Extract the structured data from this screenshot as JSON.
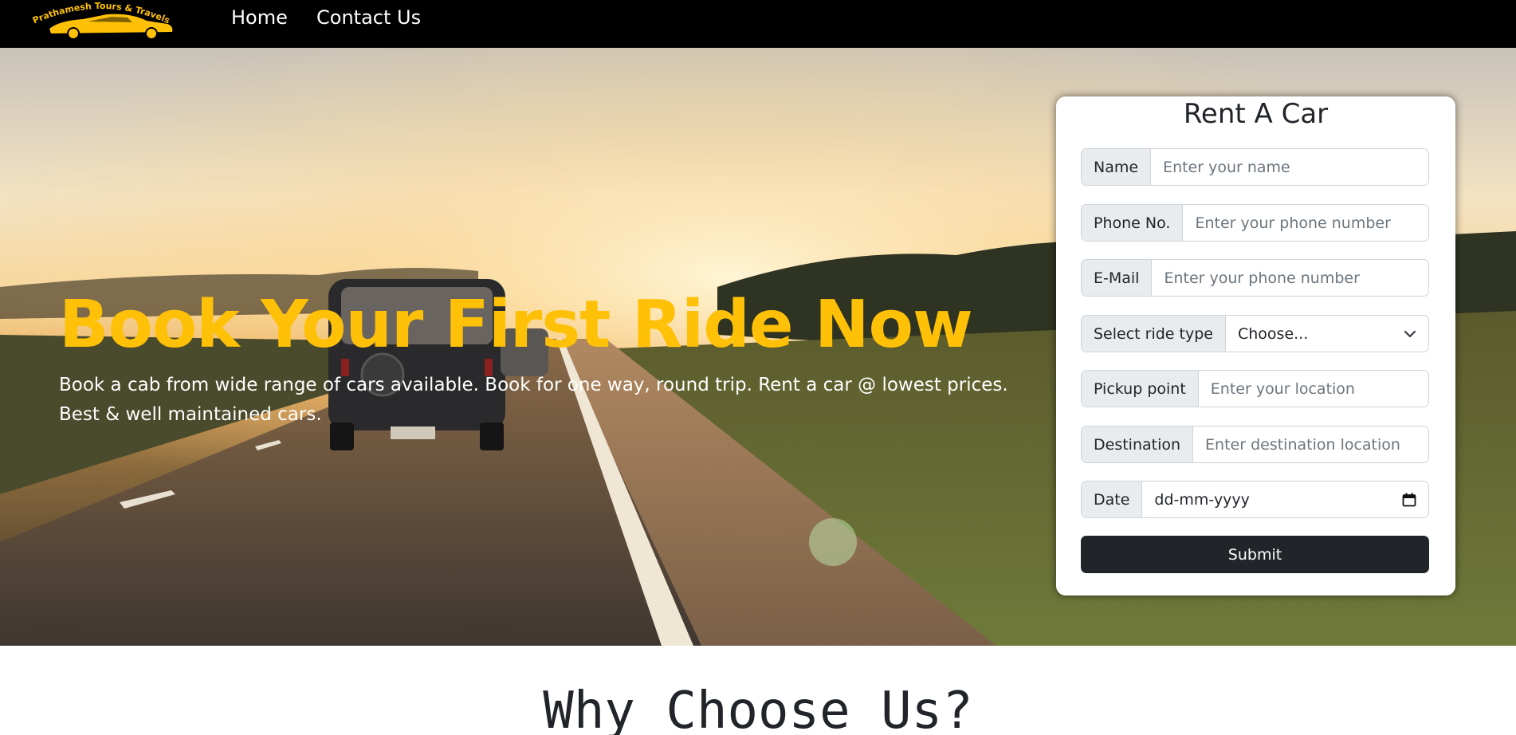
{
  "nav": {
    "logo_text": "Prathamesh Tours & Travels",
    "home": "Home",
    "contact": "Contact Us"
  },
  "hero": {
    "title": "Book Your First Ride Now",
    "subtitle": "Book a cab from wide range of cars available. Book for one way, round trip. Rent a car @ lowest prices. Best & well maintained cars."
  },
  "form": {
    "title": "Rent A Car",
    "name_label": "Name",
    "name_placeholder": "Enter your name",
    "phone_label": "Phone No.",
    "phone_placeholder": "Enter your phone number",
    "email_label": "E-Mail",
    "email_placeholder": "Enter your phone number",
    "ride_label": "Select ride type",
    "ride_value": "Choose...",
    "pickup_label": "Pickup point",
    "pickup_placeholder": "Enter your location",
    "dest_label": "Destination",
    "dest_placeholder": "Enter destination location",
    "date_label": "Date",
    "date_placeholder": "dd-mm-yyyy",
    "submit": "Submit"
  },
  "section": {
    "why_title": "Why Choose Us?"
  },
  "colors": {
    "accent": "#ffc107",
    "navbar": "#000000",
    "button": "#212529"
  }
}
